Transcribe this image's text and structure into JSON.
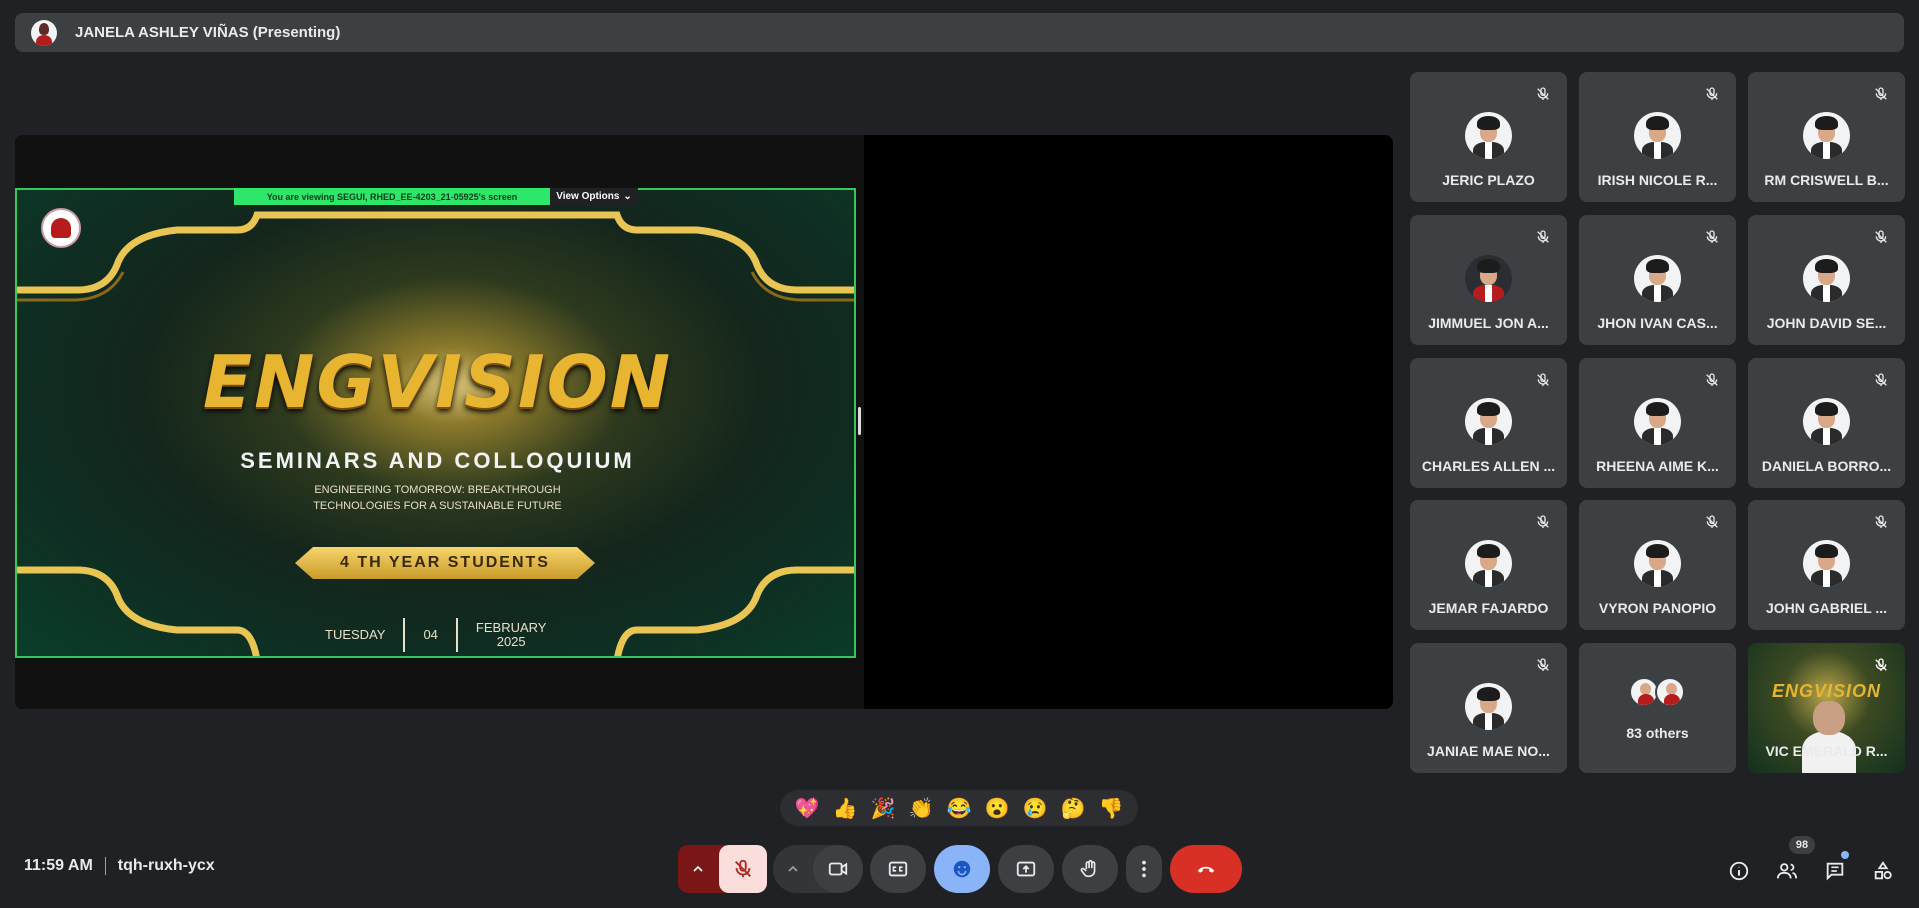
{
  "header": {
    "presenter_title": "JANELA ASHLEY VIÑAS (Presenting)"
  },
  "screen_share": {
    "viewing_banner": "You are viewing SEGUI, RHED_EE-4203_21-05925's screen",
    "view_options_label": "View Options",
    "slide": {
      "title": "ENGVISION",
      "subtitle": "SEMINARS AND COLLOQUIUM",
      "tagline_line1": "ENGINEERING TOMORROW: BREAKTHROUGH",
      "tagline_line2": "TECHNOLOGIES FOR A SUSTAINABLE FUTURE",
      "ribbon": "4 TH YEAR STUDENTS",
      "day": "TUESDAY",
      "date": "04",
      "month": "FEBRUARY",
      "year": "2025"
    }
  },
  "participants": [
    {
      "name": "JERIC PLAZO",
      "muted": true
    },
    {
      "name": "IRISH NICOLE R...",
      "muted": true
    },
    {
      "name": "RM CRISWELL B...",
      "muted": true
    },
    {
      "name": "JIMMUEL JON A...",
      "muted": true
    },
    {
      "name": "JHON IVAN CAS...",
      "muted": true
    },
    {
      "name": "JOHN DAVID SE...",
      "muted": true
    },
    {
      "name": "CHARLES ALLEN ...",
      "muted": true
    },
    {
      "name": "RHEENA AIME K...",
      "muted": true
    },
    {
      "name": "DANIELA BORRO...",
      "muted": true
    },
    {
      "name": "JEMAR FAJARDO",
      "muted": true
    },
    {
      "name": "VYRON PANOPIO",
      "muted": true
    },
    {
      "name": "JOHN GABRIEL ...",
      "muted": true
    },
    {
      "name": "JANIAE MAE NO...",
      "muted": true
    },
    {
      "name": "83 others",
      "muted": false
    },
    {
      "name": "VIC EMERALD R...",
      "muted": true
    }
  ],
  "reactions": [
    "💖",
    "👍",
    "🎉",
    "👏",
    "😂",
    "😮",
    "😢",
    "🤔",
    "👎"
  ],
  "footer": {
    "time": "11:59 AM",
    "meeting_code": "tqh-ruxh-ycx",
    "people_count": "98"
  },
  "colors": {
    "background": "#202124",
    "tile": "#3c4043",
    "leave_button": "#d93025",
    "mic_muted_bg": "#f9dedc",
    "reactions_active": "#8ab4f8",
    "share_border": "#34c759"
  }
}
